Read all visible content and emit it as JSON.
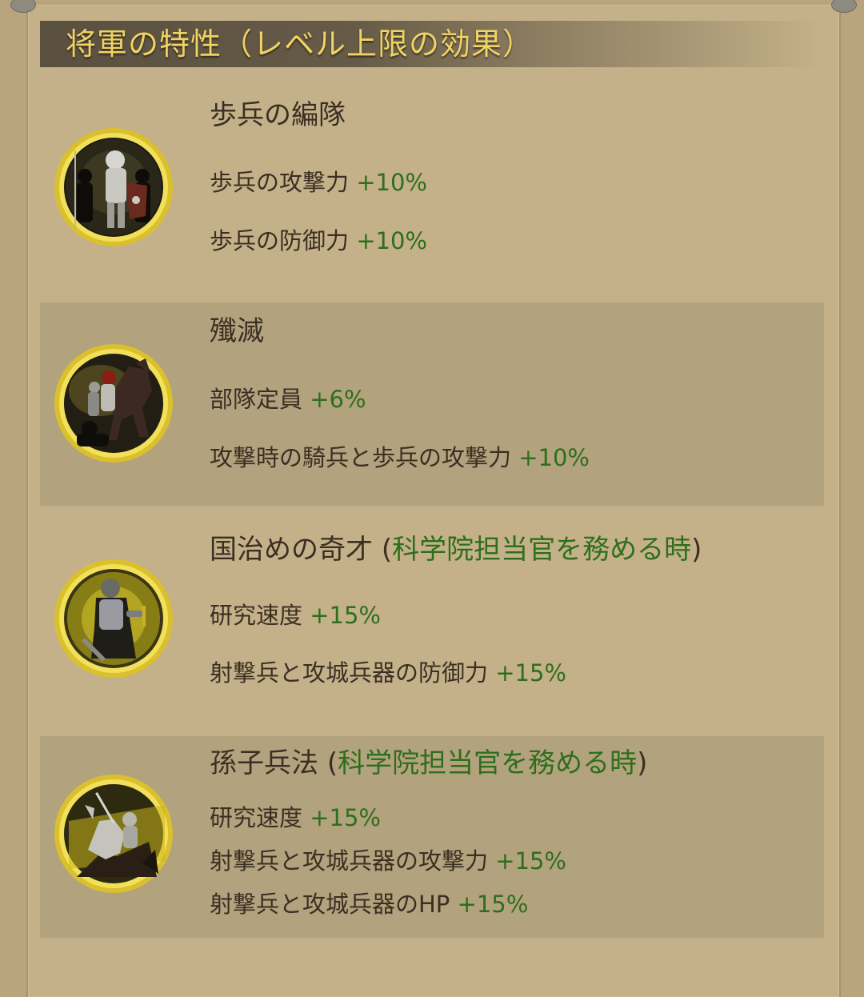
{
  "header": {
    "title": "将軍の特性（レベル上限の効果）"
  },
  "colors": {
    "bonus_green": "#2e6e1c",
    "title_gold": "#f1d264",
    "text_brown": "#3b2e22",
    "panel_bg": "#c4b189",
    "ring_gold": "#e8cf3a"
  },
  "traits": [
    {
      "icon": "infantry-knights-icon",
      "title": "歩兵の編隊",
      "title_suffix": "",
      "effects": [
        {
          "label": "歩兵の攻撃力",
          "value": "+10%"
        },
        {
          "label": "歩兵の防御力",
          "value": "+10%"
        }
      ]
    },
    {
      "icon": "cavalry-charge-icon",
      "title": "殲滅",
      "title_suffix": "",
      "effects": [
        {
          "label": "部隊定員",
          "value": "+6%"
        },
        {
          "label": "攻撃時の騎兵と歩兵の攻撃力",
          "value": "+10%"
        }
      ]
    },
    {
      "icon": "armored-general-icon",
      "title": "国治めの奇才 ",
      "title_paren_open": "(",
      "title_suffix": "科学院担当官を務める時",
      "title_paren_close": ")",
      "effects": [
        {
          "label": "研究速度",
          "value": "+15%"
        },
        {
          "label": "射撃兵と攻城兵器の防御力",
          "value": "+15%"
        }
      ]
    },
    {
      "icon": "mounted-knight-icon",
      "title": "孫子兵法 ",
      "title_paren_open": "(",
      "title_suffix": "科学院担当官を務める時",
      "title_paren_close": ")",
      "effects": [
        {
          "label": "研究速度",
          "value": "+15%"
        },
        {
          "label": "射撃兵と攻城兵器の攻撃力",
          "value": "+15%"
        },
        {
          "label": "射撃兵と攻城兵器のHP",
          "value": "+15%"
        }
      ]
    }
  ]
}
